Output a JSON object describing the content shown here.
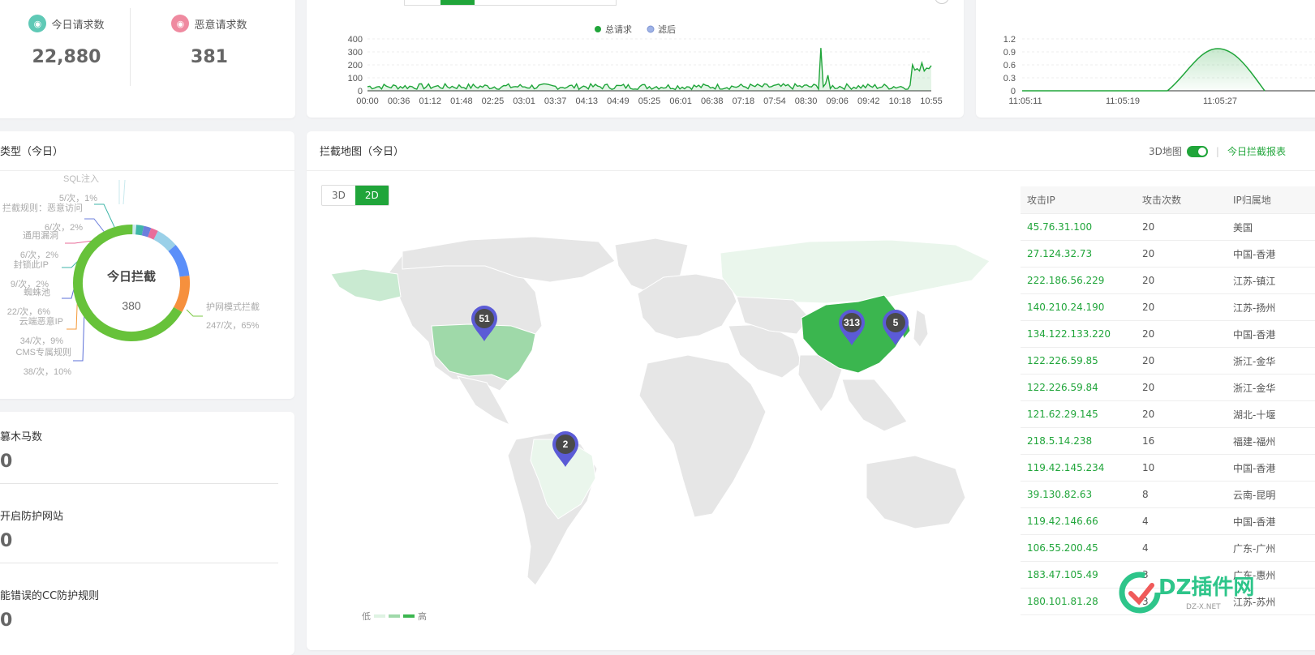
{
  "stats": {
    "today_requests": {
      "label": "今日请求数",
      "value": "22,880"
    },
    "malicious_requests": {
      "label": "恶意请求数",
      "value": "381"
    }
  },
  "request_chart": {
    "legend_total": "总请求",
    "legend_filtered": "滤后",
    "y_ticks": [
      "400",
      "300",
      "200",
      "100",
      "0"
    ],
    "x_ticks": [
      "00:00",
      "00:36",
      "01:12",
      "01:48",
      "02:25",
      "03:01",
      "03:37",
      "04:13",
      "04:49",
      "05:25",
      "06:01",
      "06:38",
      "07:18",
      "07:54",
      "08:30",
      "09:06",
      "09:42",
      "10:18",
      "10:55"
    ]
  },
  "realtime_chart": {
    "y_ticks": [
      "1.2",
      "0.9",
      "0.6",
      "0.3",
      "0"
    ],
    "x_ticks": [
      "11:05:11",
      "11:05:19",
      "11:05:27"
    ]
  },
  "types_card": {
    "title": "类型（今日）",
    "center_title": "今日拦截",
    "center_value": "380",
    "labels": [
      {
        "name": "SQL注入",
        "detail": "5/次，1%"
      },
      {
        "name": "拦截规则：恶意访问",
        "detail": "6/次，2%"
      },
      {
        "name": "通用漏洞",
        "detail": "6/次，2%"
      },
      {
        "name": "封锁此IP",
        "detail": "9/次，2%"
      },
      {
        "name": "蜘蛛池",
        "detail": "22/次，6%"
      },
      {
        "name": "云端恶意IP",
        "detail": "34/次，9%"
      },
      {
        "name": "CMS专属规则",
        "detail": "38/次，10%"
      },
      {
        "name": "护网模式拦截",
        "detail": "247/次，65%"
      }
    ]
  },
  "bottom_left": {
    "items": [
      {
        "label": "篡木马数",
        "value": "0"
      },
      {
        "label": "开启防护网站",
        "value": "0"
      },
      {
        "label": "能错误的CC防护规则",
        "value": "0"
      }
    ]
  },
  "map_card": {
    "title": "拦截地图（今日）",
    "toggle_3d_label": "3D地图",
    "report_link": "今日拦截报表",
    "view_3d": "3D",
    "view_2d": "2D",
    "scale_low": "低",
    "scale_high": "高",
    "markers": [
      {
        "region": "usa",
        "count": "51"
      },
      {
        "region": "brazil",
        "count": "2"
      },
      {
        "region": "china",
        "count": "313"
      },
      {
        "region": "korea",
        "count": "5"
      }
    ]
  },
  "ip_table": {
    "headers": [
      "攻击IP",
      "攻击次数",
      "IP归属地"
    ],
    "rows": [
      {
        "ip": "45.76.31.100",
        "count": "20",
        "location": "美国"
      },
      {
        "ip": "27.124.32.73",
        "count": "20",
        "location": "中国-香港"
      },
      {
        "ip": "222.186.56.229",
        "count": "20",
        "location": "江苏-镇江"
      },
      {
        "ip": "140.210.24.190",
        "count": "20",
        "location": "江苏-扬州"
      },
      {
        "ip": "134.122.133.220",
        "count": "20",
        "location": "中国-香港"
      },
      {
        "ip": "122.226.59.85",
        "count": "20",
        "location": "浙江-金华"
      },
      {
        "ip": "122.226.59.84",
        "count": "20",
        "location": "浙江-金华"
      },
      {
        "ip": "121.62.29.145",
        "count": "20",
        "location": "湖北-十堰"
      },
      {
        "ip": "218.5.14.238",
        "count": "16",
        "location": "福建-福州"
      },
      {
        "ip": "119.42.145.234",
        "count": "10",
        "location": "中国-香港"
      },
      {
        "ip": "39.130.82.63",
        "count": "8",
        "location": "云南-昆明"
      },
      {
        "ip": "119.42.146.66",
        "count": "4",
        "location": "中国-香港"
      },
      {
        "ip": "106.55.200.45",
        "count": "4",
        "location": "广东-广州"
      },
      {
        "ip": "183.47.105.49",
        "count": "3",
        "location": "广东-惠州"
      },
      {
        "ip": "180.101.81.28",
        "count": "3",
        "location": "江苏-苏州"
      }
    ]
  },
  "watermark": {
    "text": "DZ插件网",
    "sub": "DZ-X.NET"
  },
  "colors": {
    "accent": "#20a53a",
    "marker": "#5b5bd6"
  }
}
